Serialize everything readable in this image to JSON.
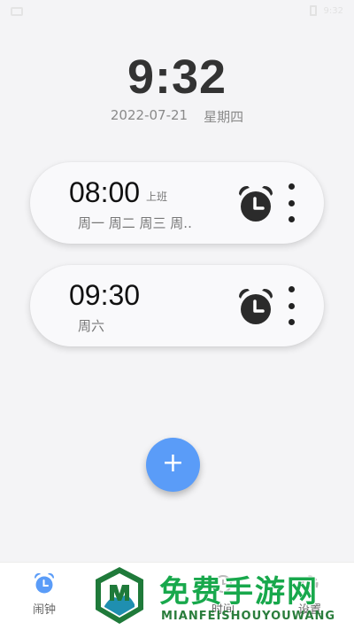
{
  "status_bar": {
    "right_text": "9:32"
  },
  "clock": {
    "time": "9:32",
    "date": "2022-07-21",
    "weekday": "星期四"
  },
  "alarms": [
    {
      "time": "08:00",
      "tag": "上班",
      "days": "周一 周二 周三 周..",
      "icon": "alarm-clock-icon"
    },
    {
      "time": "09:30",
      "tag": "",
      "days": "周六",
      "icon": "alarm-clock-icon"
    }
  ],
  "fab": {
    "label": "+"
  },
  "bottom_nav": [
    {
      "label": "闹钟",
      "icon": "alarm-icon",
      "active": true
    },
    {
      "label": "",
      "icon": "timer-icon",
      "active": false
    },
    {
      "label": "时间",
      "icon": "clock-icon",
      "active": false
    },
    {
      "label": "设置",
      "icon": "settings-icon",
      "active": false
    }
  ],
  "watermark": {
    "title": "免费手游网",
    "subtitle": "MIANFEISHOUYOUWANG"
  },
  "colors": {
    "accent": "#5a9cf8",
    "background": "#f4f4f6",
    "card": "#f9f9fb",
    "watermark_green": "#18a84c"
  }
}
